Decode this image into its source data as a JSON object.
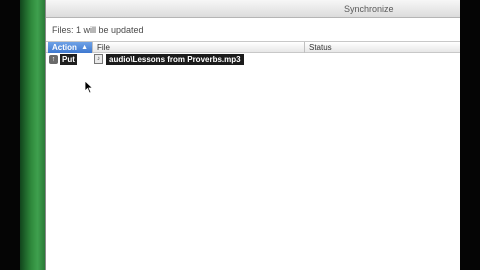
{
  "window": {
    "title": "Synchronize"
  },
  "summary": {
    "text": "Files: 1 will be updated"
  },
  "table": {
    "columns": {
      "action": "Action",
      "file": "File",
      "status": "Status"
    },
    "rows": [
      {
        "action": "Put",
        "file": "audio\\Lessons from Proverbs.mp3",
        "status": ""
      }
    ]
  },
  "icons": {
    "sort": "sort-ascending-icon",
    "row_action": "upload-icon",
    "file": "file-icon",
    "pointer": "mouse-cursor-icon"
  },
  "colors": {
    "accent": "#3e78d0",
    "green_edge": "#3fa04e"
  }
}
